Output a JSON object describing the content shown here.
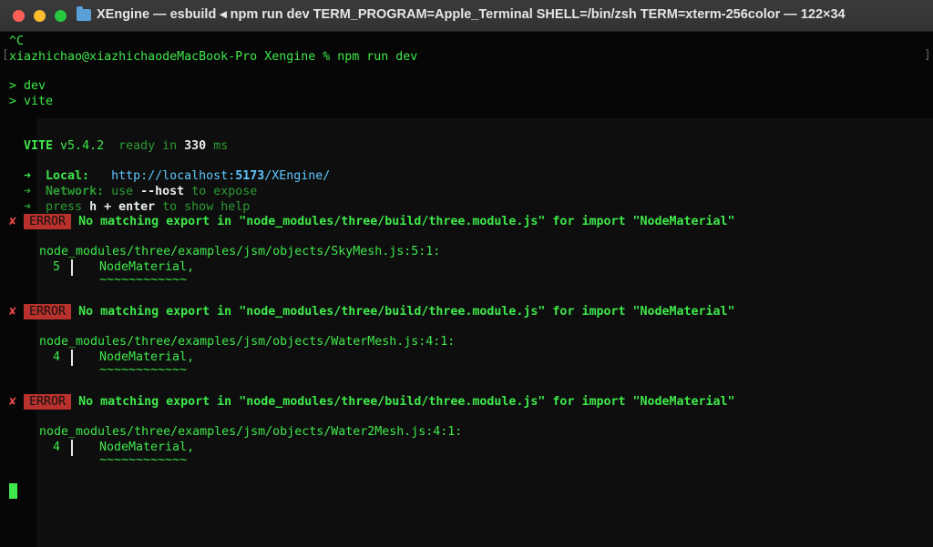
{
  "window": {
    "title": "XEngine — esbuild ◂ npm run dev TERM_PROGRAM=Apple_Terminal SHELL=/bin/zsh TERM=xterm-256color — 122×34"
  },
  "terminal": {
    "ctrl_c": "^C",
    "prompt": "xiazhichao@xiazhichaodeMacBook-Pro Xengine % npm run dev",
    "script_line1": "> dev",
    "script_line2": "> vite",
    "vite": {
      "name": "VITE",
      "version": "v5.4.2",
      "ready_label": "ready in",
      "ready_ms": "330",
      "ms_unit": "ms"
    },
    "local": {
      "arrow": "➜",
      "label": "Local:",
      "url_prefix": "http://localhost:",
      "port": "5173",
      "path": "/XEngine/"
    },
    "network": {
      "arrow": "➜",
      "label": "Network:",
      "pre": "use",
      "flag": "--host",
      "post": "to expose"
    },
    "help": {
      "arrow": "➜",
      "pre": "press",
      "key": "h + enter",
      "post": "to show help"
    },
    "errors": [
      {
        "mark": "✘",
        "badge": "ERROR",
        "message": "No matching export in \"node_modules/three/build/three.module.js\" for import \"NodeMaterial\"",
        "file": "node_modules/three/examples/jsm/objects/SkyMesh.js:5:1:",
        "line_no": "5",
        "code": "NodeMaterial,",
        "squiggle": "~~~~~~~~~~~~"
      },
      {
        "mark": "✘",
        "badge": "ERROR",
        "message": "No matching export in \"node_modules/three/build/three.module.js\" for import \"NodeMaterial\"",
        "file": "node_modules/three/examples/jsm/objects/WaterMesh.js:4:1:",
        "line_no": "4",
        "code": "NodeMaterial,",
        "squiggle": "~~~~~~~~~~~~"
      },
      {
        "mark": "✘",
        "badge": "ERROR",
        "message": "No matching export in \"node_modules/three/build/three.module.js\" for import \"NodeMaterial\"",
        "file": "node_modules/three/examples/jsm/objects/Water2Mesh.js:4:1:",
        "line_no": "4",
        "code": "NodeMaterial,",
        "squiggle": "~~~~~~~~~~~~"
      }
    ]
  },
  "colors": {
    "text_green": "#3ee84a",
    "error_badge": "#b8312c",
    "cyan": "#5fc7ff"
  }
}
